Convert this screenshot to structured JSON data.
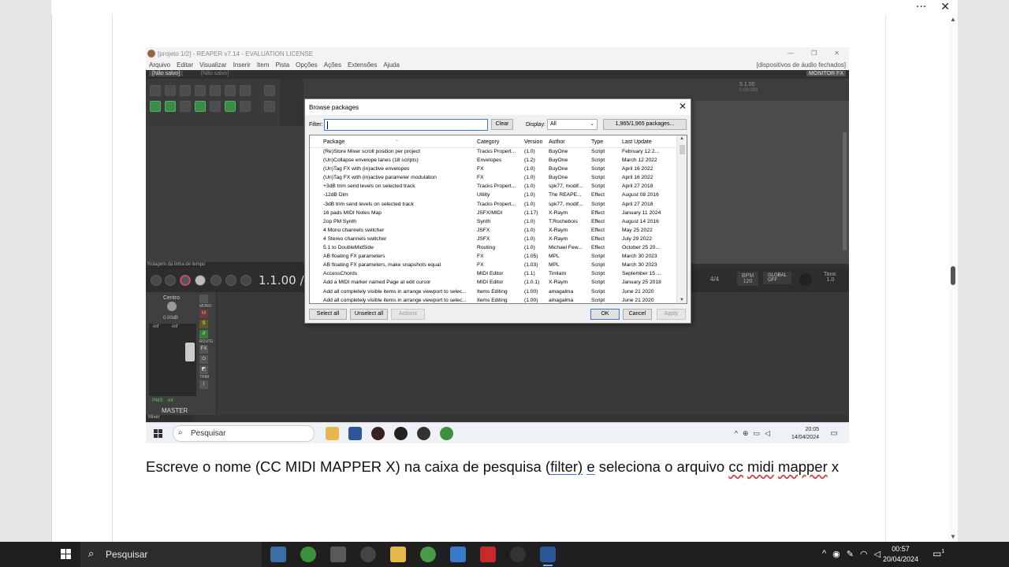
{
  "viewer": {
    "top_icons": [
      "···",
      "✕"
    ]
  },
  "reaper": {
    "window_title": "[projeto 1/2] - REAPER v7.14 - EVALUATION LICENSE",
    "menu": [
      "Arquivo",
      "Editar",
      "Visualizar",
      "Inserir",
      "Item",
      "Pista",
      "Opções",
      "Ações",
      "Extensões",
      "Ajuda"
    ],
    "audio_status": "[dispositivos de áudio fechados]",
    "tab_active": "[Não salvo]",
    "tab_inactive": "[Não salvo]",
    "monitor_fx": "MONITOR FX",
    "ruler_pos": "5.1.00",
    "ruler_time": "0:08.000",
    "rolagem_label": "Rolagem da linha de tempo",
    "time_display": "1.1.00 /",
    "time_signature": "4/4",
    "bpm_label": "BPM",
    "bpm_value": "120",
    "global_label": "GLOBAL",
    "global_value": "OFF",
    "taxa_label": "Taxa:",
    "taxa_value": "1.0",
    "mixer": {
      "pan_label": "Centro",
      "mono_label": "MONO",
      "db_value": "0.00dB",
      "inf_left": "-inf",
      "inf_right": "-inf",
      "rms_label": "RMS",
      "rms_value": "-inf",
      "master_label": "MASTER",
      "m_btn": "M",
      "s_btn": "S",
      "route_label": "ROUTE",
      "fx_label": "FX",
      "trim_label": "TRIM",
      "info_btn": "i",
      "tab_label": "Mixer"
    },
    "taskbar": {
      "search_text": "Pesquisar",
      "time": "20:05",
      "date": "14/04/2024"
    }
  },
  "dialog": {
    "title": "Browse packages",
    "close": "✕",
    "filter_label": "Filter:",
    "filter_value": "",
    "clear_label": "Clear",
    "display_label": "Display:",
    "display_value": "All",
    "count_label": "1,965/1,965 packages...",
    "columns": [
      "Package",
      "Category",
      "Version",
      "Author",
      "Type",
      "Last Update"
    ],
    "rows": [
      [
        "(Re)Store Mixer scroll position per project",
        "Tracks Propert...",
        "(1.0)",
        "BuyOne",
        "Script",
        "February 12 2..."
      ],
      [
        "(Un)Collapse envelope lanes (18 scripts)",
        "Envelopes",
        "(1.2)",
        "BuyOne",
        "Script",
        "March 12 2022"
      ],
      [
        "(Un)Tag FX with (in)active envelopes",
        "FX",
        "(1.0)",
        "BuyOne",
        "Script",
        "April 16 2022"
      ],
      [
        "(Un)Tag FX with (in)active parameter modulation",
        "FX",
        "(1.0)",
        "BuyOne",
        "Script",
        "April 16 2022"
      ],
      [
        "+3dB trim send levels on selected track",
        "Tracks Propert...",
        "(1.0)",
        "spk77, modif...",
        "Script",
        "April 27 2018"
      ],
      [
        "-12dB Dim",
        "Utility",
        "(1.0)",
        "The REAPE...",
        "Effect",
        "August 08 2016"
      ],
      [
        "-3dB trim send levels on selected track",
        "Tracks Propert...",
        "(1.0)",
        "spk77, modif...",
        "Script",
        "April 27 2018"
      ],
      [
        "16 pads MIDI Notes Map",
        "JSFX/MIDI",
        "(1.17)",
        "X-Raym",
        "Effect",
        "January 11 2024"
      ],
      [
        "2op PM Synth",
        "Synth",
        "(1.0)",
        "T.Rochebois",
        "Effect",
        "August 14 2016"
      ],
      [
        "4 Mono channels switcher",
        "JSFX",
        "(1.0)",
        "X-Raym",
        "Effect",
        "May 25 2022"
      ],
      [
        "4 Stereo channels switcher",
        "JSFX",
        "(1.0)",
        "X-Raym",
        "Effect",
        "July 29 2022"
      ],
      [
        "5.1 to DoubleMidSide",
        "Routing",
        "(1.0)",
        "Michael Few...",
        "Effect",
        "October 25 20..."
      ],
      [
        "AB floating FX parameters",
        "FX",
        "(1.05)",
        "MPL",
        "Script",
        "March 30 2023"
      ],
      [
        "AB floating FX parameters, make snapshots equal",
        "FX",
        "(1.03)",
        "MPL",
        "Script",
        "March 30 2023"
      ],
      [
        "AccessChords",
        "MIDI Editor",
        "(1.1)",
        "Timtam",
        "Script",
        "September 15 ..."
      ],
      [
        "Add a MIDI marker named Page at edit cursor",
        "MIDI Editor",
        "(1.0.1)",
        "X-Raym",
        "Script",
        "January 25 2018"
      ],
      [
        "Add all completely visible items in arrange viewport to selec...",
        "Items Editing",
        "(1.00)",
        "amagalma",
        "Script",
        "June 21 2020"
      ],
      [
        "Add all completely visible items in arrange viewport to selec...",
        "Items Editing",
        "(1.00)",
        "amagalma",
        "Script",
        "June 21 2020"
      ]
    ],
    "buttons": {
      "select_all": "Select all",
      "unselect_all": "Unselect all",
      "actions": "Actions",
      "ok": "OK",
      "cancel": "Cancel",
      "apply": "Apply"
    }
  },
  "caption": {
    "p1": "Escreve o nome (CC MIDI MAPPER X) na caixa de pesquisa (",
    "p2": "filter)",
    "p3": "  ",
    "p4": "e",
    "p5": " seleciona o arquivo ",
    "p6": "cc",
    "p7": " ",
    "p8": "midi",
    "p9": " ",
    "p10": "mapper",
    "p11": " x"
  },
  "taskbar": {
    "search_text": "Pesquisar",
    "time": "00:57",
    "date": "20/04/2024",
    "notif_count": "1"
  }
}
